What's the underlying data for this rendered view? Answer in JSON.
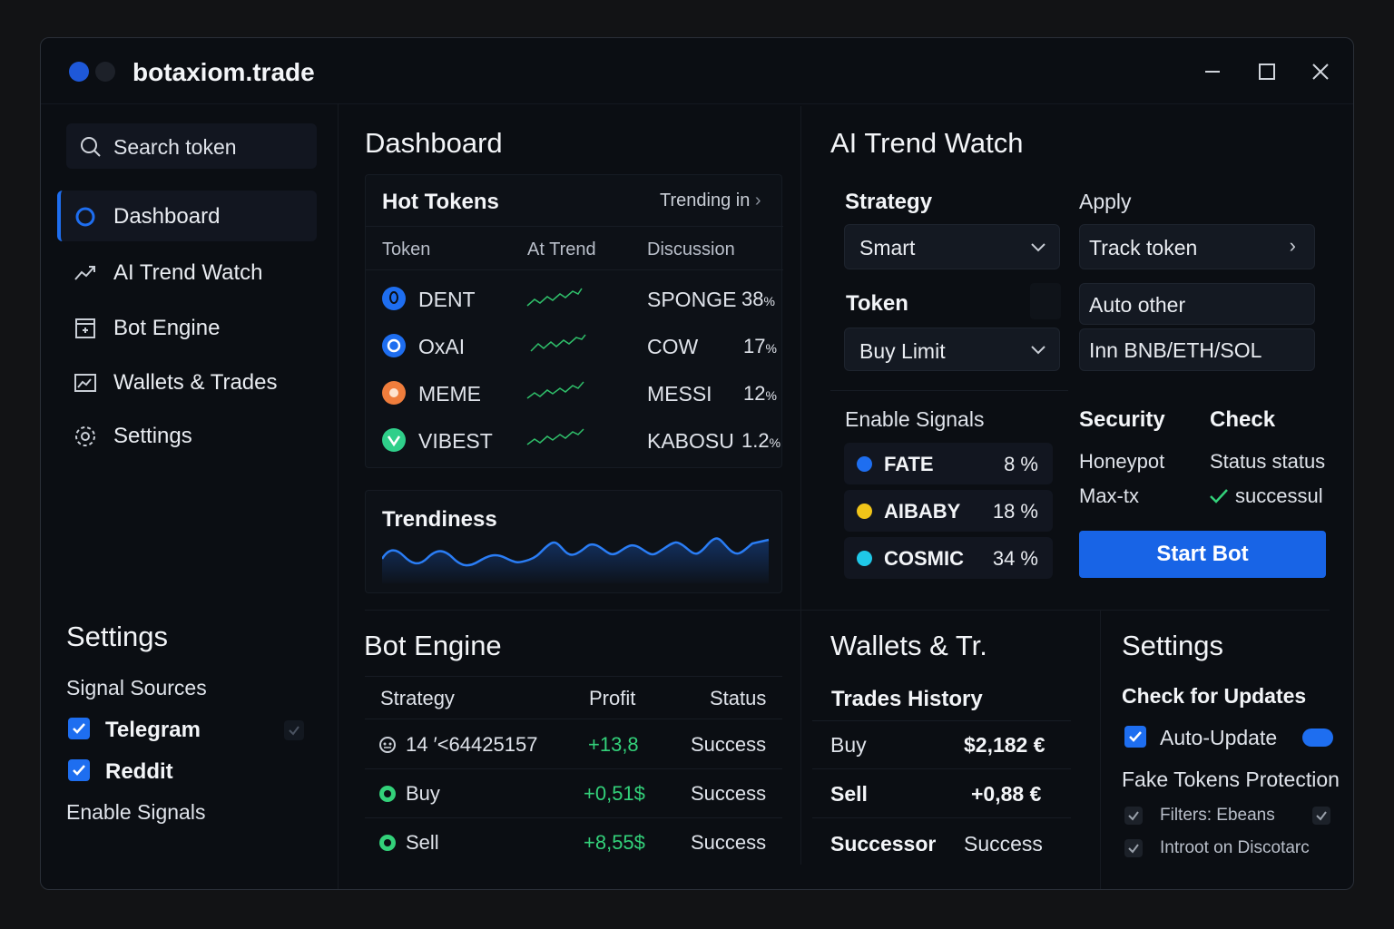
{
  "app": {
    "title": "botaxiom.trade"
  },
  "sidebar": {
    "search_placeholder": "Search token",
    "nav": [
      {
        "label": "Dashboard",
        "icon": "circle-icon",
        "active": true
      },
      {
        "label": "AI Trend Watch",
        "icon": "trend-icon"
      },
      {
        "label": "Bot Engine",
        "icon": "bot-icon"
      },
      {
        "label": "Wallets & Trades",
        "icon": "wallet-icon"
      },
      {
        "label": "Settings",
        "icon": "gear-icon"
      }
    ],
    "settings": {
      "title": "Settings",
      "signal_sources": "Signal Sources",
      "sources": [
        {
          "label": "Telegram",
          "checked": true
        },
        {
          "label": "Reddit",
          "checked": true
        }
      ],
      "enable_signals": "Enable Signals"
    }
  },
  "dashboard": {
    "title": "Dashboard",
    "hot_tokens": {
      "title": "Hot Tokens",
      "trending_link": "Trending in",
      "columns": [
        "Token",
        "At Trend",
        "Discussion"
      ],
      "rows": [
        {
          "token": "DENT",
          "discussion": "SPONGE",
          "pct": "38",
          "unit": "%"
        },
        {
          "token": "OxAI",
          "discussion": "COW",
          "pct": "17",
          "unit": "%"
        },
        {
          "token": "MEME",
          "discussion": "MESSI",
          "pct": "12",
          "unit": "%"
        },
        {
          "token": "VIBEST",
          "discussion": "KABOSU",
          "pct": "1.2",
          "unit": "%"
        }
      ]
    },
    "trendiness": {
      "title": "Trendiness"
    }
  },
  "ai_trend": {
    "title": "AI Trend Watch",
    "strategy_label": "Strategy",
    "strategy_value": "Smart",
    "apply_label": "Apply",
    "track_token": "Track token",
    "token_label": "Token",
    "token_value": "Buy Limit",
    "auto_other": "Auto other",
    "chains": "Inn BNB/ETH/SOL",
    "enable_signals": "Enable Signals",
    "signals": [
      {
        "name": "FATE",
        "pct": "8 %",
        "color": "#1e6ef0"
      },
      {
        "name": "AIBABY",
        "pct": "18 %",
        "color": "#f0c419"
      },
      {
        "name": "COSMIC",
        "pct": "34 %",
        "color": "#1fc8e8"
      }
    ],
    "security_label": "Security",
    "check_label": "Check",
    "security_items": [
      "Honeypot",
      "Max-tx"
    ],
    "check_items": [
      "Status status",
      "successul"
    ],
    "start_button": "Start Bot"
  },
  "bot_engine": {
    "title": "Bot Engine",
    "columns": [
      "Strategy",
      "Profit",
      "Status"
    ],
    "rows": [
      {
        "strategy": "14 ′<64425157",
        "profit": "+13,8",
        "status": "Success"
      },
      {
        "strategy": "Buy",
        "profit": "+0,51$",
        "status": "Success"
      },
      {
        "strategy": "Sell",
        "profit": "+8,55$",
        "status": "Success"
      }
    ]
  },
  "wallets": {
    "title": "Wallets & Tr.",
    "history_title": "Trades History",
    "rows": [
      {
        "label": "Buy",
        "value": "$2,182 €"
      },
      {
        "label": "Sell",
        "value": "+0,88 €"
      },
      {
        "label": "Successor",
        "value": "Success"
      }
    ]
  },
  "settings_panel": {
    "title": "Settings",
    "check_updates": "Check for Updates",
    "auto_update": "Auto-Update",
    "fake_tokens": "Fake Tokens Protection",
    "filters": "Filters: Ebeans",
    "introot": "Introot on Discotarc"
  }
}
